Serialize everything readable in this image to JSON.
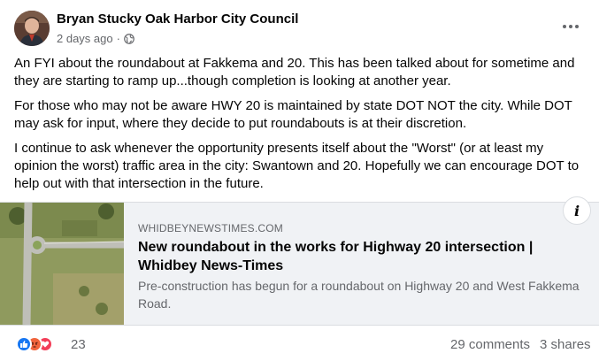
{
  "post": {
    "author": "Bryan Stucky Oak Harbor City Council",
    "timestamp": "2 days ago",
    "privacy_icon": "globe-icon",
    "paragraphs": [
      "An FYI about the roundabout at Fakkema and 20. This has been talked about for sometime and they are starting to ramp up...though completion is looking at another year.",
      "For those who may not be aware HWY 20 is maintained by state DOT NOT the city. While DOT may ask for input, where they decide to put roundabouts is at their discretion.",
      "I continue to ask whenever the opportunity presents itself about the \"Worst\" (or at least my opinion the worst) traffic area in the city: Swantown and 20. Hopefully we can encourage DOT to help out with that intersection in the future."
    ]
  },
  "link_preview": {
    "domain": "WHIDBEYNEWSTIMES.COM",
    "title": "New roundabout in the works for Highway 20 intersection | Whidbey News-Times",
    "description": "Pre-construction has begun for a roundabout on Highway 20 and West Fakkema Road.",
    "info_label": "i"
  },
  "footer": {
    "reactions": [
      "like-icon",
      "angry-icon",
      "love-icon"
    ],
    "reaction_count": "23",
    "comments": "29 comments",
    "shares": "3 shares"
  },
  "colors": {
    "like": "#1877f2",
    "angry": "#f0643c",
    "love": "#f33e58",
    "secondary_text": "#65676b"
  }
}
